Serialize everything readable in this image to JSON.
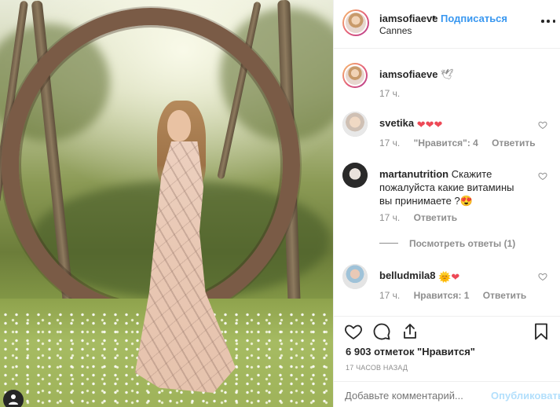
{
  "header": {
    "username": "iamsofiaeve",
    "separator": "•",
    "follow_label": "Подписаться",
    "location": "Cannes",
    "more_icon": "more-horizontal-icon"
  },
  "caption": {
    "username": "iamsofiaeve",
    "text": "🕊",
    "time": "17 ч."
  },
  "comments": [
    {
      "username": "svetika",
      "text": "❤❤❤",
      "time": "17 ч.",
      "likes": "\"Нравится\": 4",
      "reply_label": "Ответить"
    },
    {
      "username": "martanutrition",
      "text": "Скажите пожалуйста какие витамины вы принимаете ?😍",
      "time": "17 ч.",
      "reply_label": "Ответить",
      "view_replies": "Посмотреть ответы (1)"
    },
    {
      "username": "belludmila8",
      "text": "🌞❤",
      "time": "17 ч.",
      "likes": "Нравится: 1",
      "reply_label": "Ответить"
    }
  ],
  "actions": {
    "like_icon": "heart-icon",
    "comment_icon": "comment-icon",
    "share_icon": "share-icon",
    "save_icon": "bookmark-icon"
  },
  "likes_count": "6 903 отметок \"Нравится\"",
  "time_ago": "17 часов назад",
  "add_comment": {
    "placeholder": "Добавьте комментарий...",
    "post_label": "Опубликовать"
  },
  "colors": {
    "accent": "#3897f0",
    "accent_disabled": "#b2dffc",
    "heart_red": "#ed4956",
    "muted_text": "#8e8e8e",
    "text": "#262626"
  }
}
